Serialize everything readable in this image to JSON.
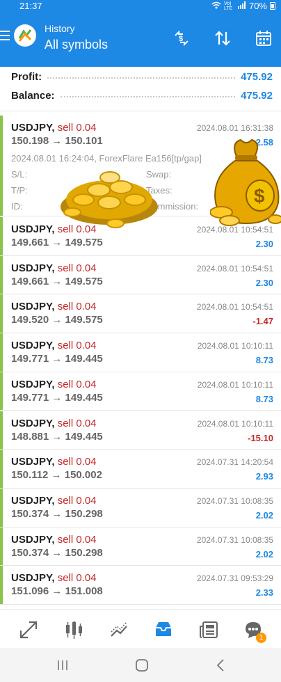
{
  "status": {
    "time": "21:37",
    "network": "Vo) LTE",
    "battery": "70%"
  },
  "header": {
    "title": "History",
    "subtitle": "All symbols"
  },
  "summary": {
    "profit_label": "Profit:",
    "profit_value": "475.92",
    "balance_label": "Balance:",
    "balance_value": "475.92"
  },
  "expanded": {
    "symbol": "USDJPY,",
    "side": "sell 0.04",
    "prices": "150.198 → 150.101",
    "time": "2024.08.01 16:31:38",
    "profit": "2.58",
    "open_line": "2024.08.01 16:24:04, ForexFlare Ea156[tp/gap]",
    "sl": "S/L:",
    "swap": "Swap:",
    "tp": "T/P:",
    "taxes": "Taxes:",
    "id": "ID:",
    "commission": "Commission:"
  },
  "deals": [
    {
      "symbol": "USDJPY,",
      "side": "sell 0.04",
      "prices": "149.661 → 149.575",
      "time": "2024.08.01 10:54:51",
      "profit": "2.30",
      "neg": false
    },
    {
      "symbol": "USDJPY,",
      "side": "sell 0.04",
      "prices": "149.661 → 149.575",
      "time": "2024.08.01 10:54:51",
      "profit": "2.30",
      "neg": false
    },
    {
      "symbol": "USDJPY,",
      "side": "sell 0.04",
      "prices": "149.520 → 149.575",
      "time": "2024.08.01 10:54:51",
      "profit": "-1.47",
      "neg": true
    },
    {
      "symbol": "USDJPY,",
      "side": "sell 0.04",
      "prices": "149.771 → 149.445",
      "time": "2024.08.01 10:10:11",
      "profit": "8.73",
      "neg": false
    },
    {
      "symbol": "USDJPY,",
      "side": "sell 0.04",
      "prices": "149.771 → 149.445",
      "time": "2024.08.01 10:10:11",
      "profit": "8.73",
      "neg": false
    },
    {
      "symbol": "USDJPY,",
      "side": "sell 0.04",
      "prices": "148.881 → 149.445",
      "time": "2024.08.01 10:10:11",
      "profit": "-15.10",
      "neg": true
    },
    {
      "symbol": "USDJPY,",
      "side": "sell 0.04",
      "prices": "150.112 → 150.002",
      "time": "2024.07.31 14:20:54",
      "profit": "2.93",
      "neg": false
    },
    {
      "symbol": "USDJPY,",
      "side": "sell 0.04",
      "prices": "150.374 → 150.298",
      "time": "2024.07.31 10:08:35",
      "profit": "2.02",
      "neg": false
    },
    {
      "symbol": "USDJPY,",
      "side": "sell 0.04",
      "prices": "150.374 → 150.298",
      "time": "2024.07.31 10:08:35",
      "profit": "2.02",
      "neg": false
    },
    {
      "symbol": "USDJPY,",
      "side": "sell 0.04",
      "prices": "151.096 → 151.008",
      "time": "2024.07.31 09:53:29",
      "profit": "2.33",
      "neg": false
    }
  ],
  "bottom_nav": [
    {
      "name": "quotes-icon"
    },
    {
      "name": "chart-icon"
    },
    {
      "name": "trade-icon"
    },
    {
      "name": "history-icon",
      "active": true
    },
    {
      "name": "news-icon"
    },
    {
      "name": "chat-icon",
      "badge": "1"
    }
  ],
  "colors": {
    "accent": "#1e88e5",
    "negative": "#c62828",
    "stripe": "#8bc34a"
  }
}
